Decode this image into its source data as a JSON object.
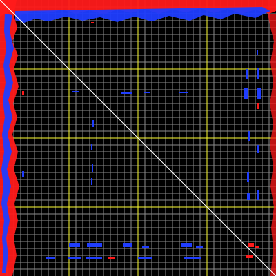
{
  "view": {
    "background_color": "#000000",
    "minor_grid_color": "#8c8c8c",
    "major_grid_color": "#ffff33",
    "diagonal_color": "#ffffff",
    "minor_grid_divisions": 40,
    "major_grid_divisions": 4
  },
  "colors": {
    "series_a": "#ff1a1a",
    "series_b": "#1f3dff"
  }
}
